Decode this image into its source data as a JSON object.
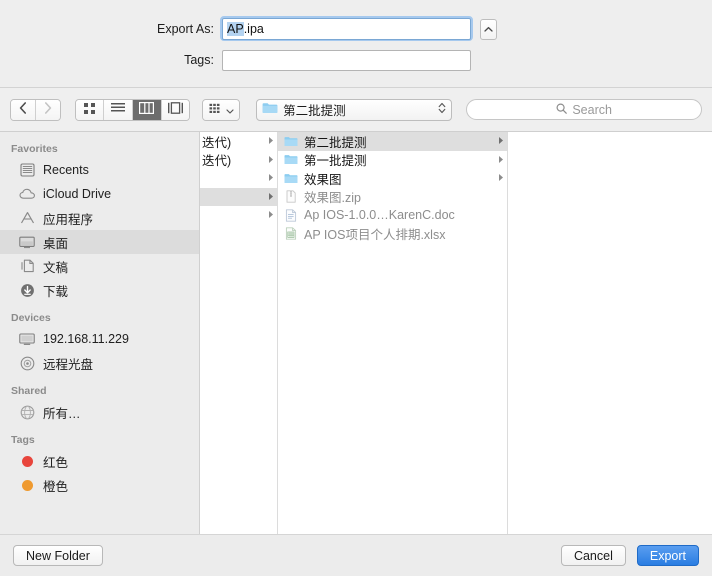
{
  "name_section": {
    "export_as_label": "Export As:",
    "filename_selected": "AP",
    "filename_rest": ".ipa",
    "filename_full": "AP.ipa",
    "tags_label": "Tags:",
    "tags_value": "",
    "tags_placeholder": "",
    "disclosure_icon": "chevron-up-icon"
  },
  "toolbar": {
    "back_icon": "chevron-left-icon",
    "forward_icon": "chevron-right-icon",
    "view_icon_label": "icon-view",
    "view_list_label": "list-view",
    "view_column_label": "column-view",
    "view_gallery_label": "gallery-view",
    "active_view": "column-view",
    "action_label": "action-menu",
    "path_folder": "第二批提测",
    "path_icon": "folder-icon",
    "search_placeholder": "Search",
    "search_value": "",
    "search_icon": "search-icon"
  },
  "sidebar": {
    "groups": [
      {
        "title": "Favorites",
        "items": [
          {
            "label": "Recents",
            "icon": "recents-icon",
            "selected": false
          },
          {
            "label": "iCloud Drive",
            "icon": "cloud-icon",
            "selected": false
          },
          {
            "label": "应用程序",
            "icon": "applications-icon",
            "selected": false
          },
          {
            "label": "桌面",
            "icon": "desktop-icon",
            "selected": true
          },
          {
            "label": "文稿",
            "icon": "documents-icon",
            "selected": false
          },
          {
            "label": "下载",
            "icon": "downloads-icon",
            "selected": false
          }
        ]
      },
      {
        "title": "Devices",
        "items": [
          {
            "label": "192.168.11.229",
            "icon": "computer-icon",
            "selected": false
          },
          {
            "label": "远程光盘",
            "icon": "disc-icon",
            "selected": false
          }
        ]
      },
      {
        "title": "Shared",
        "items": [
          {
            "label": "所有…",
            "icon": "network-globe-icon",
            "selected": false
          }
        ]
      },
      {
        "title": "Tags",
        "items": [
          {
            "label": "红色",
            "icon": "tag-dot-icon",
            "color": "#e8453c",
            "selected": false
          },
          {
            "label": "橙色",
            "icon": "tag-dot-icon",
            "color": "#ef9a30",
            "selected": false
          }
        ]
      }
    ]
  },
  "browser": {
    "column1": [
      {
        "label": "迭代)",
        "type": "folder-truncated",
        "arrow": true,
        "selected": false
      },
      {
        "label": "迭代)",
        "type": "folder-truncated",
        "arrow": true,
        "selected": false
      },
      {
        "label": "",
        "type": "folder-truncated",
        "arrow": true,
        "selected": false
      },
      {
        "label": "",
        "type": "folder-truncated",
        "arrow": true,
        "selected": true
      },
      {
        "label": "",
        "type": "folder-truncated",
        "arrow": true,
        "selected": false
      }
    ],
    "column2": [
      {
        "label": "第二批提测",
        "type": "folder",
        "icon": "folder-icon",
        "arrow": true,
        "selected": true,
        "dim": false
      },
      {
        "label": "第一批提测",
        "type": "folder",
        "icon": "folder-icon",
        "arrow": true,
        "selected": false,
        "dim": false
      },
      {
        "label": "效果图",
        "type": "folder",
        "icon": "folder-icon",
        "arrow": true,
        "selected": false,
        "dim": false
      },
      {
        "label": "效果图.zip",
        "type": "file",
        "icon": "archive-icon",
        "arrow": false,
        "selected": false,
        "dim": true
      },
      {
        "label": "Ap IOS-1.0.0…KarenC.doc",
        "type": "file",
        "icon": "doc-icon",
        "arrow": false,
        "selected": false,
        "dim": true
      },
      {
        "label": "AP IOS项目个人排期.xlsx",
        "type": "file",
        "icon": "xls-icon",
        "arrow": false,
        "selected": false,
        "dim": true
      }
    ],
    "column3": []
  },
  "bottom": {
    "new_folder_label": "New Folder",
    "cancel_label": "Cancel",
    "export_label": "Export",
    "export_accent": "#2a7de2"
  }
}
